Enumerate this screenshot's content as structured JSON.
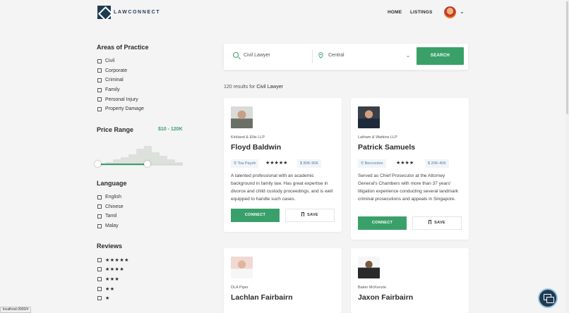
{
  "header": {
    "brand": "LAWCONNECT",
    "nav": [
      {
        "label": "HOME"
      },
      {
        "label": "LISTINGS"
      }
    ]
  },
  "sidebar": {
    "areas_title": "Areas of Practice",
    "areas": [
      "Civil",
      "Corporate",
      "Criminal",
      "Family",
      "Personal Injury",
      "Property Damage"
    ],
    "price_title": "Price Range",
    "price_value": "$10 - 120K",
    "price_histogram": [
      2,
      3,
      5,
      7,
      9,
      14,
      16,
      11,
      8,
      5,
      3
    ],
    "price_selection": {
      "min_fraction": 0.0,
      "max_fraction": 0.58
    },
    "language_title": "Language",
    "languages": [
      "English",
      "Chinese",
      "Tamil",
      "Malay"
    ],
    "reviews_title": "Reviews",
    "review_options": [
      5,
      4,
      3,
      2,
      1
    ]
  },
  "search": {
    "query": "Civil Lawyer",
    "location": "Central",
    "button_label": "SEARCH"
  },
  "results": {
    "count_text": "120 results for",
    "query": "Civil Lawyer"
  },
  "lawyers": [
    {
      "firm": "Kirkland & Ellis LLP",
      "name": "Floyd Baldwin",
      "location": "Toa Payoh",
      "rating": 5,
      "price": "$ 80K-90K",
      "description": "A talented professional with an academic background in family law. Has great expertise in divorce and child custody proceedings, and is well equipped to handle such cases.",
      "connect_label": "CONNECT",
      "save_label": "SAVE"
    },
    {
      "firm": "Latham & Watkins LLP",
      "name": "Patrick Samuels",
      "location": "Bencoolen",
      "rating": 4,
      "price": "$ 20K-40K",
      "description": "Served as Chief Prosecutor at the Attorney General's Chambers with more than 37 years' litigation experience conducting several landmark criminal prosecutions and appeals in Singapore.",
      "connect_label": "CONNECT",
      "save_label": "SAVE"
    },
    {
      "firm": "DLA Piper",
      "name": "Lachlan Fairbairn"
    },
    {
      "firm": "Baker McKenzie",
      "name": "Jaxon Fairbairn"
    }
  ],
  "status": {
    "url": "localhost:3000/#"
  },
  "colors": {
    "accent": "#3aa06a",
    "brand": "#1f3b52",
    "tag_text": "#4a7fa6"
  },
  "icons": {
    "search": "search-icon",
    "location": "pin-icon",
    "bookmark": "bookmark-icon",
    "chat": "chat-icon"
  }
}
